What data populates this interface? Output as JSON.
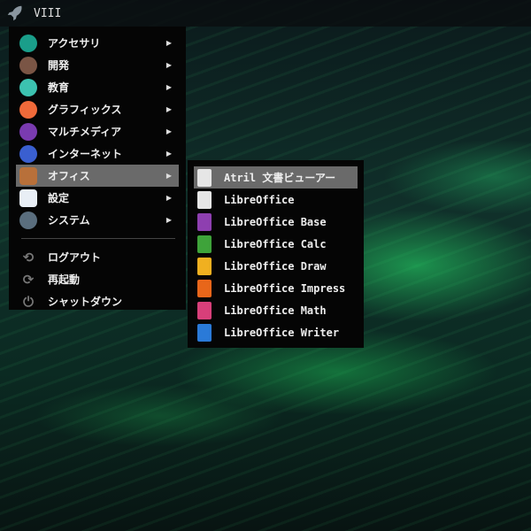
{
  "topbar": {
    "title": "VIII"
  },
  "main_menu": {
    "categories": [
      {
        "label": "アクセサリ",
        "icon": "accessories-icon",
        "color": "#1a9e8a"
      },
      {
        "label": "開発",
        "icon": "hammer-icon",
        "color": "#7a5545"
      },
      {
        "label": "教育",
        "icon": "education-icon",
        "color": "#3cc2b0"
      },
      {
        "label": "グラフィックス",
        "icon": "graphics-icon",
        "color": "#f06a3a"
      },
      {
        "label": "マルチメディア",
        "icon": "multimedia-icon",
        "color": "#7a3bb0"
      },
      {
        "label": "インターネット",
        "icon": "globe-icon",
        "color": "#3a5fd0"
      },
      {
        "label": "オフィス",
        "icon": "briefcase-icon",
        "color": "#b8703a"
      },
      {
        "label": "設定",
        "icon": "settings-icon",
        "color": "#e8eef5"
      },
      {
        "label": "システム",
        "icon": "gear-icon",
        "color": "#5a6e7e"
      }
    ],
    "actions": [
      {
        "label": "ログアウト",
        "icon": "logout-icon"
      },
      {
        "label": "再起動",
        "icon": "restart-icon"
      },
      {
        "label": "シャットダウン",
        "icon": "power-icon"
      }
    ]
  },
  "submenu": {
    "items": [
      {
        "label": "Atril 文書ビューアー",
        "icon": "document-viewer-icon",
        "color": "#e6e6e6"
      },
      {
        "label": "LibreOffice",
        "icon": "libreoffice-icon",
        "color": "#e6e6e6"
      },
      {
        "label": "LibreOffice Base",
        "icon": "libreoffice-base-icon",
        "color": "#8e3fb0"
      },
      {
        "label": "LibreOffice Calc",
        "icon": "libreoffice-calc-icon",
        "color": "#3ea33a"
      },
      {
        "label": "LibreOffice Draw",
        "icon": "libreoffice-draw-icon",
        "color": "#f0b020"
      },
      {
        "label": "LibreOffice Impress",
        "icon": "libreoffice-impress-icon",
        "color": "#e8661a"
      },
      {
        "label": "LibreOffice Math",
        "icon": "libreoffice-math-icon",
        "color": "#d83f7a"
      },
      {
        "label": "LibreOffice Writer",
        "icon": "libreoffice-writer-icon",
        "color": "#2a7ad8"
      }
    ]
  }
}
